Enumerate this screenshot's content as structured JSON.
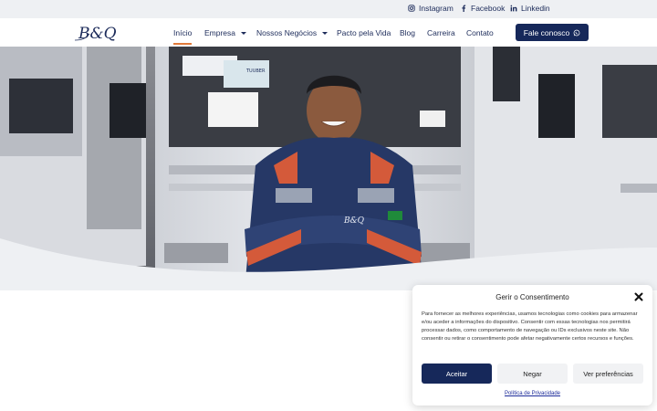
{
  "social": {
    "instagram": "Instagram",
    "facebook": "Facebook",
    "linkedin": "Linkedin"
  },
  "header": {
    "logo_text": "B&Q",
    "nav": [
      {
        "label": "Início",
        "active": true,
        "dropdown": false
      },
      {
        "label": "Empresa",
        "active": false,
        "dropdown": true
      },
      {
        "label": "Nossos Negócios",
        "active": false,
        "dropdown": true
      },
      {
        "label": "Pacto pela Vida",
        "active": false,
        "dropdown": false
      },
      {
        "label": "Blog",
        "active": false,
        "dropdown": false
      },
      {
        "label": "Carreira",
        "active": false,
        "dropdown": false
      },
      {
        "label": "Contato",
        "active": false,
        "dropdown": false
      }
    ],
    "cta_label": "Fale conosco"
  },
  "hero": {
    "vest_text": "B&Q",
    "windshield_text": "TUUBER"
  },
  "consent": {
    "title": "Gerir o Consentimento",
    "text": "Para fornecer as melhores experiências, usamos tecnologias como cookies para armazenar e/ou aceder a informações do dispositivo. Consentir com essas tecnologias nos permitirá processar dados, como comportamento de navegação ou IDs exclusivos neste site. Não consentir ou retirar o consentimento pode afetar negativamente certos recursos e funções.",
    "accept_label": "Aceitar",
    "deny_label": "Negar",
    "prefs_label": "Ver preferências",
    "privacy_label": "Política de Privacidade"
  },
  "colors": {
    "brand_navy": "#16285a",
    "accent_orange": "#e07a3a"
  }
}
